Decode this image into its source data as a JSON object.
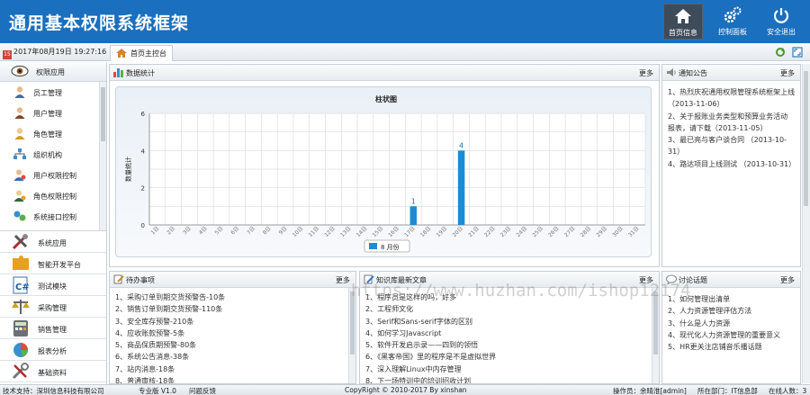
{
  "header": {
    "title": "通用基本权限系统框架",
    "nav": [
      {
        "label": "首页信息",
        "icon": "home-icon",
        "active": true
      },
      {
        "label": "控制面板",
        "icon": "gears-icon",
        "active": false
      },
      {
        "label": "安全退出",
        "icon": "power-icon",
        "active": false
      }
    ]
  },
  "tabbar": {
    "datetime": "2017年08月19日 19:27:16",
    "calendar_icon_text": "15",
    "home_tab": "首页主控台"
  },
  "sidebar": {
    "top_group": "权限应用",
    "sub_items": [
      "员工管理",
      "用户管理",
      "角色管理",
      "组织机构",
      "用户权限控制",
      "角色权限控制",
      "系统接口控制"
    ],
    "groups": [
      "系统应用",
      "智能开发平台",
      "测试模块",
      "采购管理",
      "销售管理",
      "报表分析",
      "基础资料"
    ]
  },
  "stats_panel": {
    "title": "数据统计",
    "more": "更多"
  },
  "chart_data": {
    "type": "bar",
    "title": "柱状图",
    "ylabel": "数量统计",
    "categories": [
      "1日",
      "2日",
      "3日",
      "4日",
      "5日",
      "6日",
      "7日",
      "8日",
      "9日",
      "10日",
      "11日",
      "12日",
      "13日",
      "14日",
      "15日",
      "16日",
      "17日",
      "18日",
      "19日",
      "20日",
      "21日",
      "22日",
      "23日",
      "24日",
      "25日",
      "26日",
      "27日",
      "28日",
      "29日",
      "30日",
      "31日"
    ],
    "series": [
      {
        "name": "8 月份",
        "values": [
          0,
          0,
          0,
          0,
          0,
          0,
          0,
          0,
          0,
          0,
          0,
          0,
          0,
          0,
          0,
          0,
          1,
          0,
          0,
          4,
          0,
          0,
          0,
          0,
          0,
          0,
          0,
          0,
          0,
          0,
          0
        ]
      }
    ],
    "data_labels": {
      "16": "1",
      "19": "4"
    },
    "y_ticks": [
      "0",
      "2",
      "4",
      "6"
    ],
    "ylim": [
      0,
      6
    ],
    "grid": true,
    "legend": "bottom"
  },
  "notice_panel": {
    "title": "通知公告",
    "more": "更多",
    "items": [
      "1、热烈庆祝通用权限管理系统框架上线",
      "（2013-11-06）",
      "2、关于报账业务类型和预算业务活动",
      "报表，请下载（2013-11-05）",
      "3、最已亮与客户谈合同 （2013-10-",
      "31）",
      "4、路达项目上线测试 （2013-10-31）"
    ]
  },
  "todo_panel": {
    "title": "待办事项",
    "more": "更多",
    "items": [
      "1、采购订单到期交货预警告-10条",
      "2、销售订单到期交货预警-110条",
      "3、安全库存预警-210条",
      "4、应收账款预警-5条",
      "5、商品保质期预警-80条",
      "6、系统公告消息-38条",
      "7、站内消息-18条",
      "8、普通审核-18条"
    ]
  },
  "knowledge_panel": {
    "title": "知识库最新文章",
    "more": "更多",
    "items": [
      "1、程序员是这样的吗，好多",
      "2、工程师文化",
      "3、Serif和Sans-serif字体的区别",
      "4、如何学习Javascript",
      "5、软件开发启示录——四到的领悟",
      "6、《黑客帝国》里的程序是不是虚拟世界",
      "7、深入理解Linux中内存管理",
      "8、下一场特训中的培训招收计划"
    ]
  },
  "discussion_panel": {
    "title": "讨论话题",
    "more": "更多",
    "items": [
      "1、如何管理出清单",
      "2、人力资源管理评估方法",
      "3、什么是人力资源",
      "4、现代化人力资源管理的重要意义",
      "5、HR更关注店铺音乐播话题"
    ]
  },
  "footer": {
    "support": "技术支持：深圳信息科技有限公司",
    "edition": "专业版 V1.0",
    "feedback": "问题反馈",
    "copyright": "CopyRight © 2010-2017 By xinshan",
    "operator": "操作员：余晴淮[admin]",
    "department": "所在部门：IT信息部",
    "online": "在线人数：3"
  },
  "watermark": "https://www.huzhan.com/ishop12174",
  "colors": {
    "header_bg": "#1a6fbe",
    "bar": "#1e8cd2",
    "active_nav": "#3f4b58"
  }
}
